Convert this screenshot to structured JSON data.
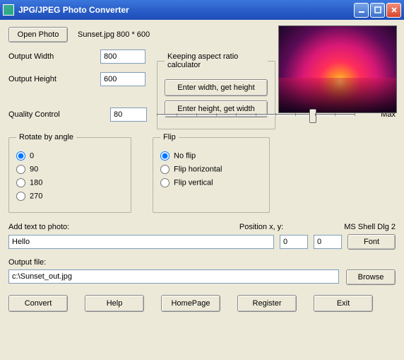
{
  "window": {
    "title": "JPG/JPEG Photo Converter"
  },
  "top": {
    "open_photo_label": "Open Photo",
    "filename_info": "Sunset.jpg 800 * 600"
  },
  "dims": {
    "width_label": "Output Width",
    "height_label": "Output Height",
    "width_value": "800",
    "height_value": "600"
  },
  "aspect": {
    "legend": "Keeping aspect ratio calculator",
    "btn_width": "Enter width, get height",
    "btn_height": "Enter height, get width"
  },
  "quality": {
    "label": "Quality Control",
    "value": "80",
    "max_label": "Max",
    "slider_percent": 80
  },
  "rotate": {
    "legend": "Rotate by angle",
    "opt0": "0",
    "opt90": "90",
    "opt180": "180",
    "opt270": "270",
    "selected": "0"
  },
  "flip": {
    "legend": "Flip",
    "opt_none": "No flip",
    "opt_h": "Flip horizontal",
    "opt_v": "Flip vertical",
    "selected": "none"
  },
  "addtext": {
    "label": "Add text to photo:",
    "value": "Hello",
    "pos_label": "Position x, y:",
    "x": "0",
    "y": "0",
    "font_info": "MS Shell Dlg 2",
    "font_btn": "Font"
  },
  "output": {
    "label": "Output file:",
    "path": "c:\\Sunset_out.jpg",
    "browse": "Browse"
  },
  "buttons": {
    "convert": "Convert",
    "help": "Help",
    "homepage": "HomePage",
    "register": "Register",
    "exit": "Exit"
  }
}
